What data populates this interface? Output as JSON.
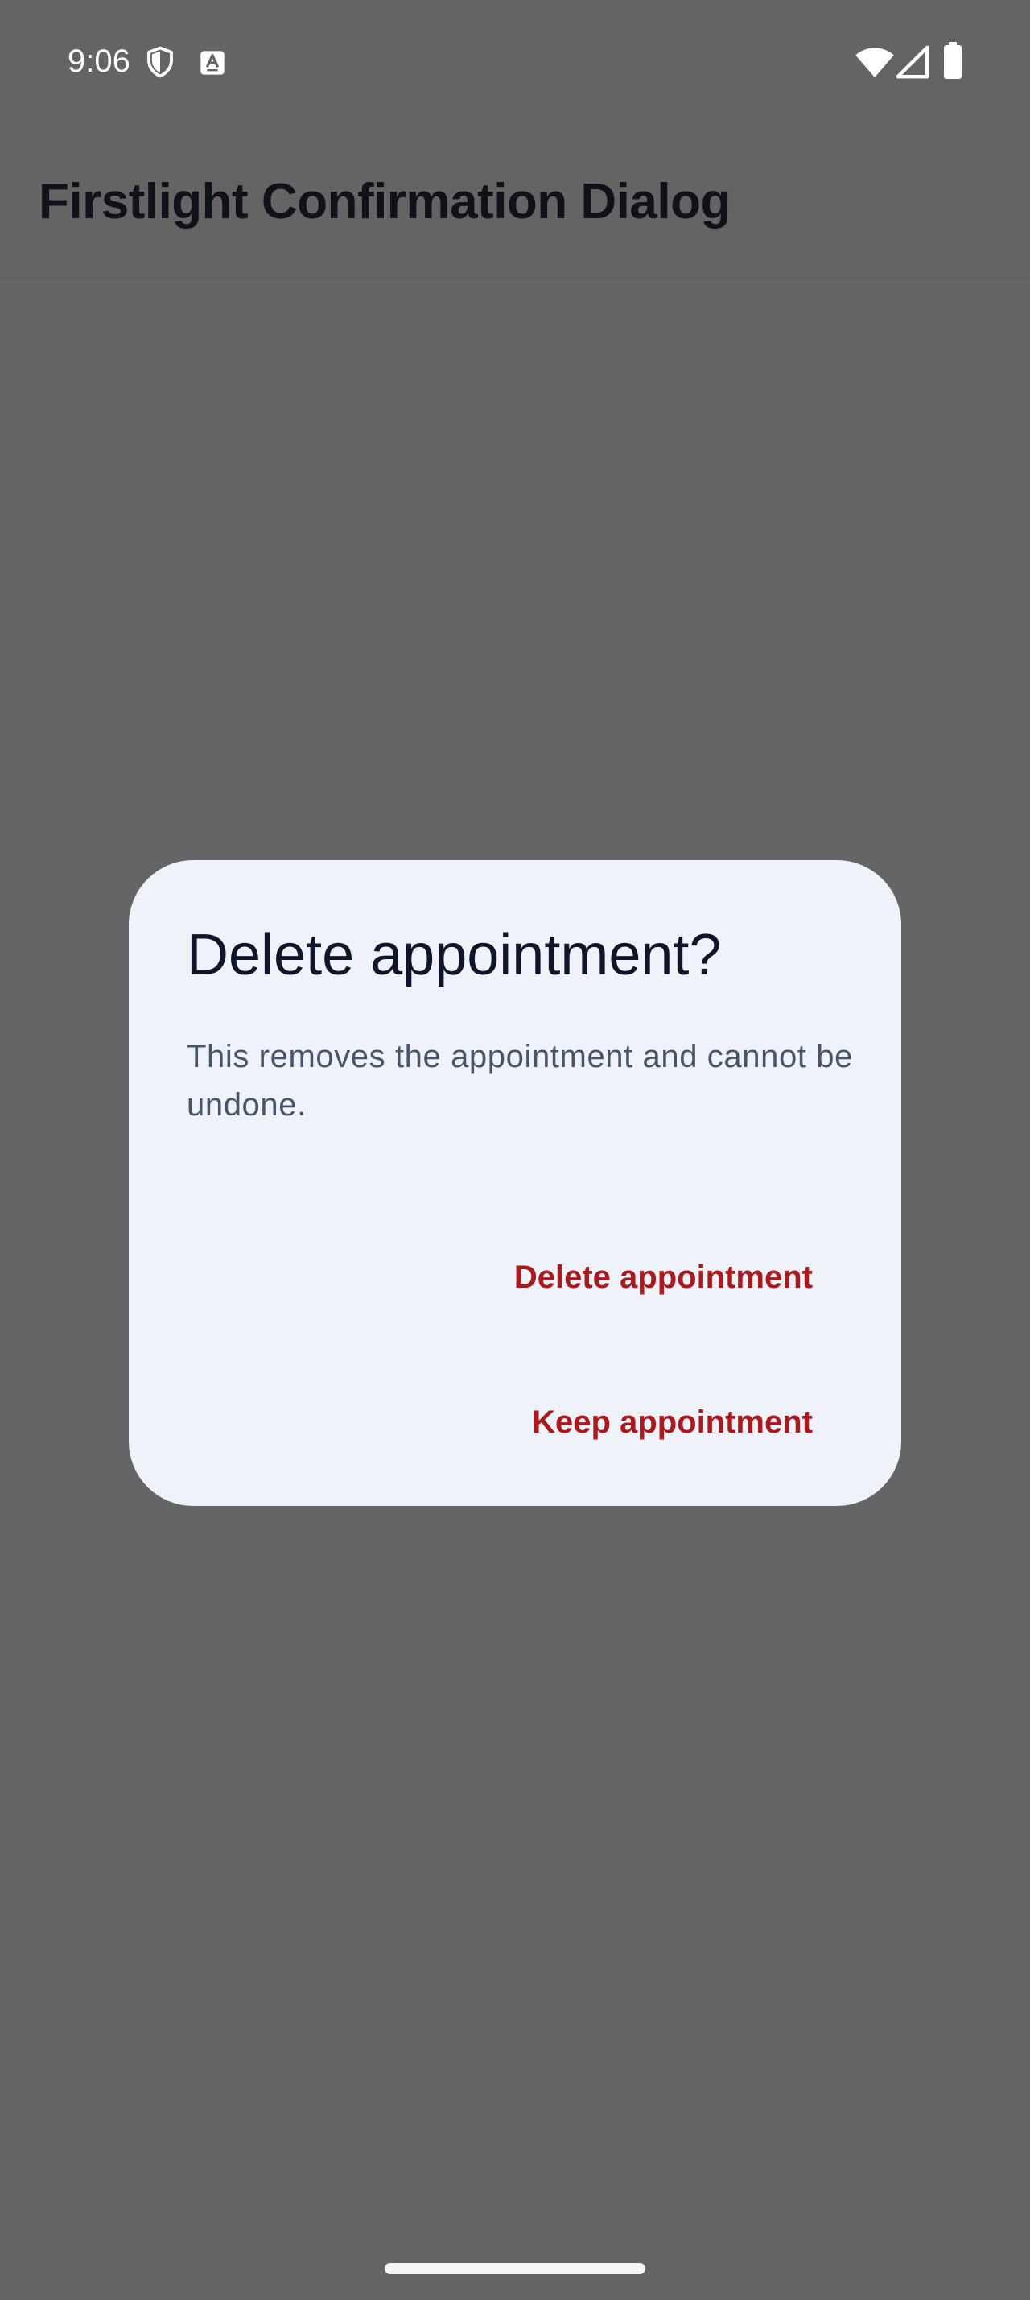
{
  "status_bar": {
    "time": "9:06",
    "left_icons": [
      "shield-icon",
      "keyboard-a-icon"
    ],
    "right_icons": [
      "wifi-icon",
      "cell-signal-icon",
      "battery-icon"
    ]
  },
  "app_bar": {
    "title": "Firstlight Confirmation Dialog"
  },
  "dialog": {
    "title": "Delete appointment?",
    "body": "This removes the appointment and cannot be undone.",
    "buttons": {
      "delete_label": "Delete appointment",
      "keep_label": "Keep appointment"
    }
  },
  "colors": {
    "scrim": "#646567",
    "dialog_bg": "#eff2f8",
    "title": "#0f1629",
    "body_text": "#475569",
    "accent": "#a91a1f"
  }
}
